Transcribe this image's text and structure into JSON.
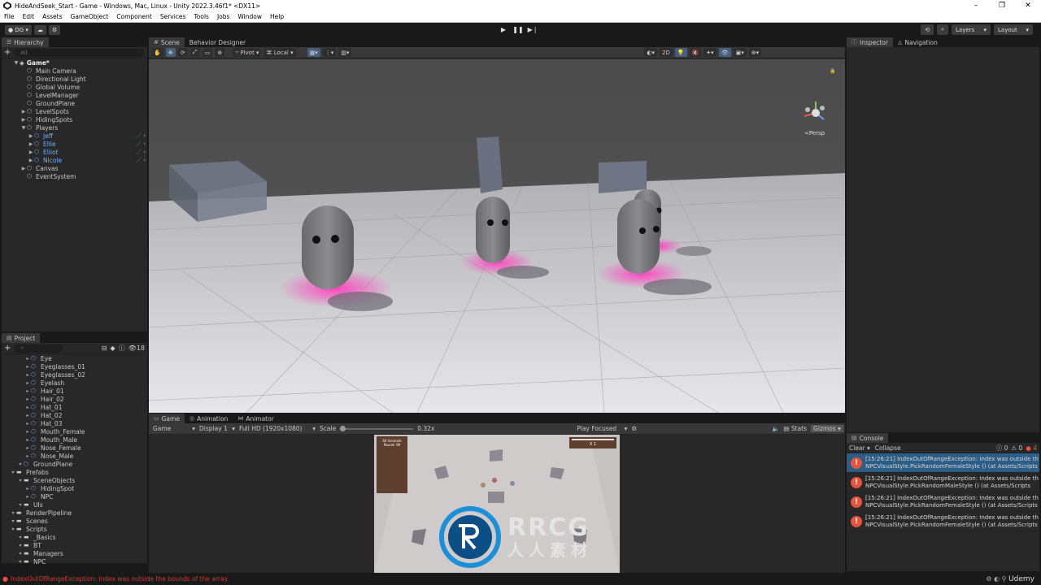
{
  "window": {
    "title": "HideAndSeek_Start - Game - Windows, Mac, Linux - Unity 2022.3.46f1* <DX11>",
    "controls": [
      "–",
      "❐",
      "✕"
    ]
  },
  "menu": [
    "File",
    "Edit",
    "Assets",
    "GameObject",
    "Component",
    "Services",
    "Tools",
    "Jobs",
    "Window",
    "Help"
  ],
  "toolbar": {
    "account": "DG",
    "layers": "Layers",
    "layout": "Layout"
  },
  "hierarchy": {
    "tab": "Hierarchy",
    "search_placeholder": "All",
    "scene": "Game*",
    "items": [
      {
        "label": "Main Camera",
        "depth": 1,
        "arrow": ""
      },
      {
        "label": "Directional Light",
        "depth": 1,
        "arrow": ""
      },
      {
        "label": "Global Volume",
        "depth": 1,
        "arrow": ""
      },
      {
        "label": "LevelManager",
        "depth": 1,
        "arrow": ""
      },
      {
        "label": "GroundPlane",
        "depth": 1,
        "arrow": ""
      },
      {
        "label": "LevelSpots",
        "depth": 1,
        "arrow": "▶"
      },
      {
        "label": "HidingSpots",
        "depth": 1,
        "arrow": "▶"
      },
      {
        "label": "Players",
        "depth": 1,
        "arrow": "▼"
      },
      {
        "label": "Jeff",
        "depth": 2,
        "arrow": "▶",
        "blue": true
      },
      {
        "label": "Ellie",
        "depth": 2,
        "arrow": "▶",
        "blue": true
      },
      {
        "label": "Elliot",
        "depth": 2,
        "arrow": "▶",
        "blue": true
      },
      {
        "label": "Nicole",
        "depth": 2,
        "arrow": "▶",
        "blue": true
      },
      {
        "label": "Canvas",
        "depth": 1,
        "arrow": "▶"
      },
      {
        "label": "EventSystem",
        "depth": 1,
        "arrow": ""
      }
    ]
  },
  "scene": {
    "tabs": [
      "Scene",
      "Behavior Designer"
    ],
    "pivot": "Pivot",
    "local": "Local",
    "mode_2d": "2D",
    "persp": "<Persp"
  },
  "game": {
    "tabs": [
      "Game",
      "Animation",
      "Animator"
    ],
    "view": "Game",
    "display": "Display 1",
    "resolution": "Full HD (1920x1080)",
    "scale_label": "Scale",
    "scale_value": "0.32x",
    "play_focused": "Play Focused",
    "stats": "Stats",
    "gizmos": "Gizmos",
    "hud_timer": "60 Seconds",
    "hud_round": "Round: 99",
    "hud_multiplier": "X 1"
  },
  "project": {
    "tab": "Project",
    "count": "18",
    "items": [
      {
        "label": "Eye",
        "depth": 2
      },
      {
        "label": "Eyeglasses_01",
        "depth": 2
      },
      {
        "label": "Eyeglasses_02",
        "depth": 2
      },
      {
        "label": "Eyelash",
        "depth": 2
      },
      {
        "label": "Hair_01",
        "depth": 2
      },
      {
        "label": "Hair_02",
        "depth": 2
      },
      {
        "label": "Hat_01",
        "depth": 2
      },
      {
        "label": "Hat_02",
        "depth": 2
      },
      {
        "label": "Hat_03",
        "depth": 2
      },
      {
        "label": "Mouth_Female",
        "depth": 2
      },
      {
        "label": "Mouth_Male",
        "depth": 2
      },
      {
        "label": "Nose_Female",
        "depth": 2
      },
      {
        "label": "Nose_Male",
        "depth": 2
      },
      {
        "label": "GroundPlane",
        "depth": 1
      },
      {
        "label": "Prefabs",
        "depth": 0
      },
      {
        "label": "SceneObjects",
        "depth": 1
      },
      {
        "label": "HidingSpot",
        "depth": 2
      },
      {
        "label": "NPC",
        "depth": 2
      },
      {
        "label": "UIs",
        "depth": 1
      },
      {
        "label": "RenderPipeline",
        "depth": 0
      },
      {
        "label": "Scenes",
        "depth": 0
      },
      {
        "label": "Scripts",
        "depth": 0
      },
      {
        "label": "_Basics",
        "depth": 1
      },
      {
        "label": "BT",
        "depth": 1
      },
      {
        "label": "Managers",
        "depth": 1
      },
      {
        "label": "NPC",
        "depth": 1
      }
    ]
  },
  "inspector": {
    "tabs": [
      "Inspector",
      "Navigation"
    ]
  },
  "console": {
    "tab": "Console",
    "clear": "Clear",
    "collapse": "Collapse",
    "counts": [
      "0",
      "0",
      "4"
    ],
    "entries": [
      {
        "line1": "[15:26:21] IndexOutOfRangeException: Index was outside th",
        "line2": "NPCVisualStyle.PickRandomFemaleStyle () (at Assets/Scripts"
      },
      {
        "line1": "[15:26:21] IndexOutOfRangeException: Index was outside th",
        "line2": "NPCVisualStyle.PickRandomMaleStyle () (at Assets/Scripts"
      },
      {
        "line1": "[15:26:21] IndexOutOfRangeException: Index was outside th",
        "line2": "NPCVisualStyle.PickRandomFemaleStyle () (at Assets/Scripts"
      },
      {
        "line1": "[15:26:21] IndexOutOfRangeException: Index was outside th",
        "line2": "NPCVisualStyle.PickRandomFemaleStyle () (at Assets/Scripts"
      }
    ]
  },
  "status": {
    "message": "IndexOutOfRangeException: Index was outside the bounds of the array."
  },
  "watermark": {
    "logo_text": "RRCG",
    "sub_text": "人人素材",
    "brand": "Udemy"
  },
  "colors": {
    "accent": "#46607c",
    "error": "#e5543c",
    "selection": "#2c5d87",
    "glow": "#ff4fc0"
  }
}
